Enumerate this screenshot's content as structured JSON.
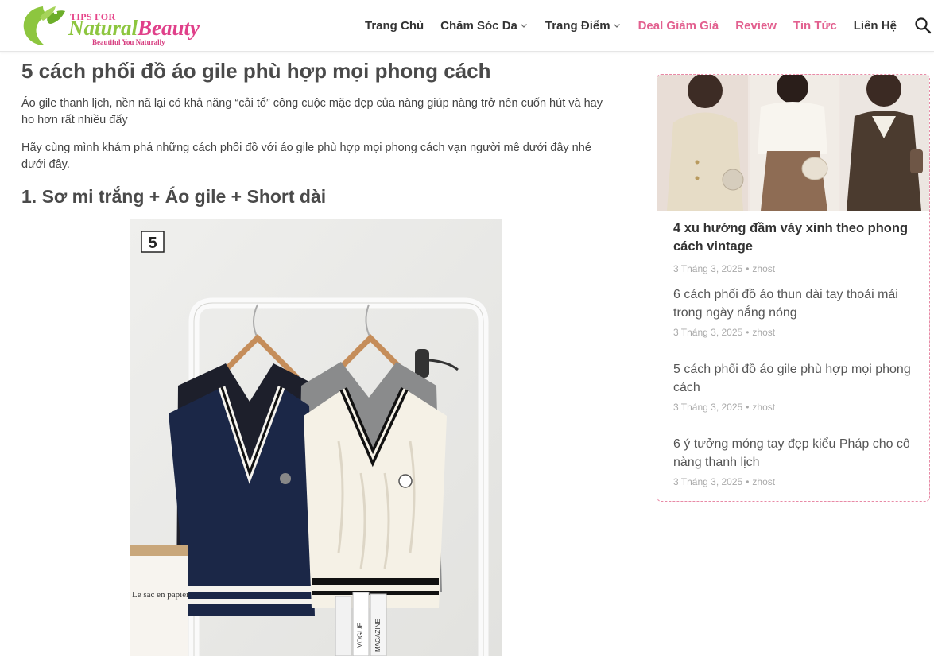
{
  "logo": {
    "tips": "TIPS FOR",
    "word1": "Natural",
    "word2": "Beauty",
    "tagline": "Beautiful You Naturally"
  },
  "nav": {
    "items": [
      {
        "label": "Trang Chủ"
      },
      {
        "label": "Chăm Sóc Da"
      },
      {
        "label": "Trang Điểm"
      },
      {
        "label": "Deal Giảm Giá"
      },
      {
        "label": "Review"
      },
      {
        "label": "Tin Tức"
      },
      {
        "label": "Liên Hệ"
      }
    ],
    "search_icon": "search-icon"
  },
  "article": {
    "title": "5 cách phối đồ áo gile phù hợp mọi phong cách",
    "intro1": "Áo gile thanh lịch, nền nã lại có khả năng “cải tổ” công cuộc mặc đẹp của nàng giúp nàng trở nên cuốn hút và hay ho hơn rất nhiều đấy",
    "intro2": "Hãy cùng mình khám phá những cách phối đồ với áo gile phù hợp mọi phong cách vạn người mê dưới đây nhé dưới đây.",
    "section1": "1. Sơ mi trắng + Áo gile + Short dài",
    "photo_badge": "5",
    "photo_bag_text": "Le sac en papier",
    "photo_book1": "VOGUE",
    "photo_book2": "MAGAZINE"
  },
  "sidebar": {
    "featured": {
      "title": "4 xu hướng đầm váy xinh theo phong cách vintage",
      "date": "3 Tháng 3, 2025",
      "author": "zhost"
    },
    "posts": [
      {
        "title": "6 cách phối đồ áo thun dài tay thoải mái trong ngày nắng nóng",
        "date": "3 Tháng 3, 2025",
        "author": "zhost"
      },
      {
        "title": "5 cách phối đồ áo gile phù hợp mọi phong cách",
        "date": "3 Tháng 3, 2025",
        "author": "zhost"
      },
      {
        "title": "6 ý tưởng móng tay đẹp kiểu Pháp cho cô nàng thanh lịch",
        "date": "3 Tháng 3, 2025",
        "author": "zhost"
      }
    ]
  },
  "colors": {
    "accent_pink": "#e2608f",
    "logo_green": "#8dc63f",
    "sidebar_border": "#e88aa6"
  }
}
